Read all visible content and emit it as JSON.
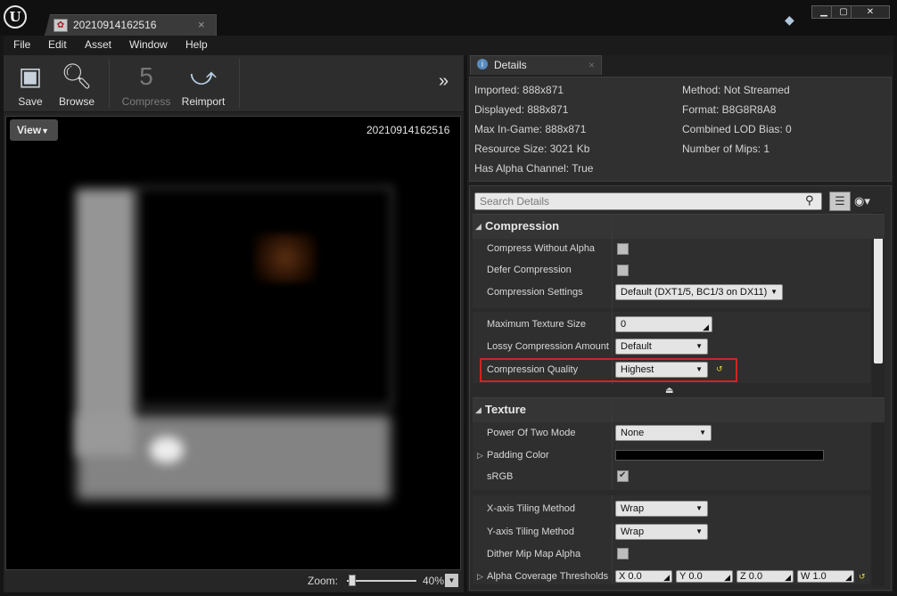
{
  "window": {
    "tab_title": "20210914162516",
    "close_glyph": "×",
    "minimize_glyph": "▁",
    "maximize_glyph": "▢",
    "close_window_glyph": "✕"
  },
  "menu": [
    "File",
    "Edit",
    "Asset",
    "Window",
    "Help"
  ],
  "toolbar": {
    "save": "Save",
    "browse": "Browse",
    "compress": "Compress",
    "reimport": "Reimport"
  },
  "viewport": {
    "view_button": "View",
    "texture_name": "20210914162516",
    "zoom_label": "Zoom:",
    "zoom_value": "40%",
    "zoom_level": 0.4
  },
  "details": {
    "tab_label": "Details",
    "info_left": [
      "Imported: 888x871",
      "Displayed: 888x871",
      "Max In-Game: 888x871",
      "Resource Size: 3021 Kb",
      "Has Alpha Channel: True"
    ],
    "info_right": [
      "Method: Not Streamed",
      "Format: B8G8R8A8",
      "Combined LOD Bias: 0",
      "Number of Mips: 1"
    ],
    "search_placeholder": "Search Details",
    "compression": {
      "title": "Compression",
      "compress_without_alpha": "Compress Without Alpha",
      "defer_compression": "Defer Compression",
      "compression_settings": "Compression Settings",
      "compression_settings_value": "Default (DXT1/5, BC1/3 on DX11)",
      "max_texture_size": "Maximum Texture Size",
      "max_texture_size_value": "0",
      "lossy_amount": "Lossy Compression Amount",
      "lossy_amount_value": "Default",
      "quality": "Compression Quality",
      "quality_value": "Highest"
    },
    "texture": {
      "title": "Texture",
      "power_of_two": "Power Of Two Mode",
      "power_of_two_value": "None",
      "padding_color": "Padding Color",
      "srgb": "sRGB",
      "x_tiling": "X-axis Tiling Method",
      "x_tiling_value": "Wrap",
      "y_tiling": "Y-axis Tiling Method",
      "y_tiling_value": "Wrap",
      "dither_mip": "Dither Mip Map Alpha",
      "alpha_coverage": "Alpha Coverage Thresholds",
      "vec": [
        {
          "axis": "X",
          "value": "0.0"
        },
        {
          "axis": "Y",
          "value": "0.0"
        },
        {
          "axis": "Z",
          "value": "0.0"
        },
        {
          "axis": "W",
          "value": "1.0"
        }
      ]
    }
  }
}
